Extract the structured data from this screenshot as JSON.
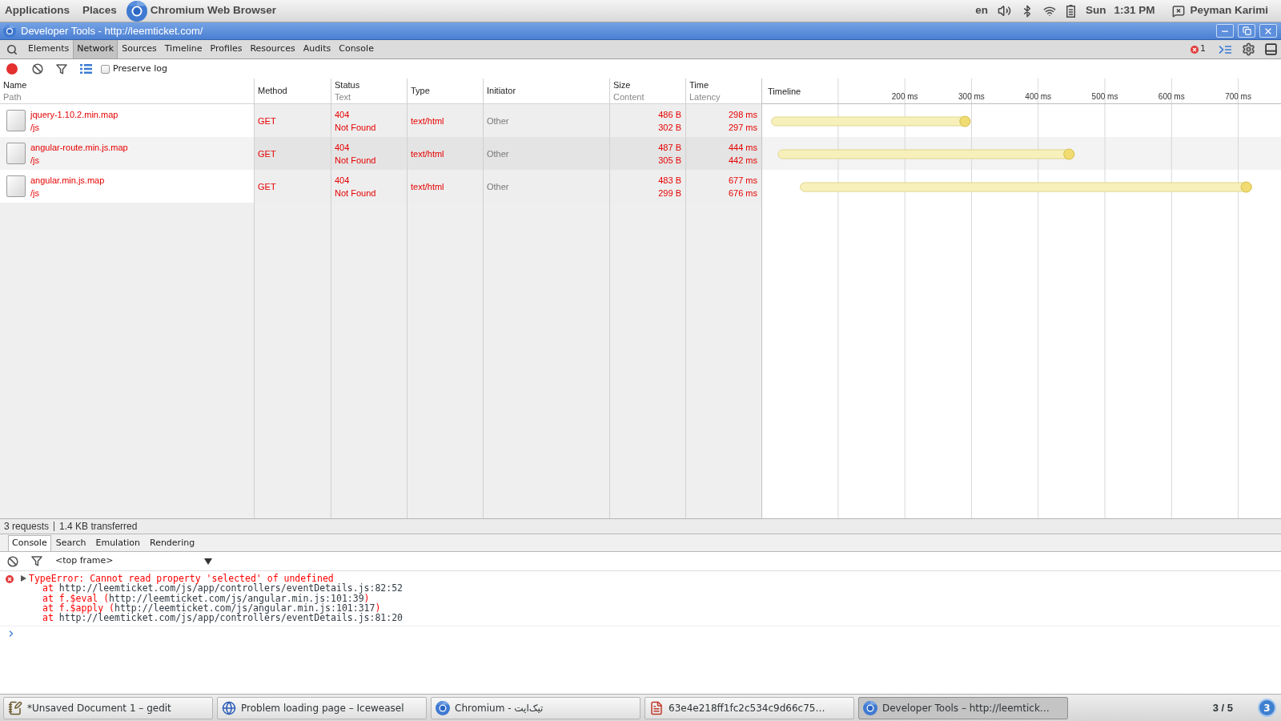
{
  "top_bar": {
    "menus": [
      "Applications",
      "Places"
    ],
    "app_name": "Chromium Web Browser",
    "language": "en",
    "day": "Sun",
    "time": "1:31 PM",
    "user": "Peyman Karimi"
  },
  "window": {
    "title": "Developer Tools - http://leemticket.com/"
  },
  "panel_tabs": [
    {
      "label": "Elements",
      "selected": false
    },
    {
      "label": "Network",
      "selected": true
    },
    {
      "label": "Sources",
      "selected": false
    },
    {
      "label": "Timeline",
      "selected": false
    },
    {
      "label": "Profiles",
      "selected": false
    },
    {
      "label": "Resources",
      "selected": false
    },
    {
      "label": "Audits",
      "selected": false
    },
    {
      "label": "Console",
      "selected": false
    }
  ],
  "error_count": "1",
  "network_toolbar": {
    "recording": true,
    "large_rows": true,
    "preserve_log": {
      "label": "Preserve log",
      "checked": false
    }
  },
  "table": {
    "columns": [
      {
        "title": "Name",
        "subtitle": "Path"
      },
      {
        "title": "Method"
      },
      {
        "title": "Status",
        "subtitle": "Text"
      },
      {
        "title": "Type"
      },
      {
        "title": "Initiator"
      },
      {
        "title": "Size",
        "subtitle": "Content"
      },
      {
        "title": "Time",
        "subtitle": "Latency"
      },
      {
        "title": "Timeline"
      }
    ],
    "rows": [
      {
        "name": "jquery-1.10.2.min.map",
        "path": "/js",
        "method": "GET",
        "status": "404",
        "status_text": "Not Found",
        "type": "text/html",
        "initiator": "Other",
        "size": "486 B",
        "content": "302 B",
        "time": "298 ms",
        "latency": "297 ms",
        "error": true
      },
      {
        "name": "angular-route.min.js.map",
        "path": "/js",
        "method": "GET",
        "status": "404",
        "status_text": "Not Found",
        "type": "text/html",
        "initiator": "Other",
        "size": "487 B",
        "content": "305 B",
        "time": "444 ms",
        "latency": "442 ms",
        "error": true
      },
      {
        "name": "angular.min.js.map",
        "path": "/js",
        "method": "GET",
        "status": "404",
        "status_text": "Not Found",
        "type": "text/html",
        "initiator": "Other",
        "size": "483 B",
        "content": "299 B",
        "time": "677 ms",
        "latency": "676 ms",
        "error": true
      }
    ]
  },
  "timeline": {
    "chart_data": {
      "type": "bar",
      "orientation": "horizontal",
      "base": [
        0,
        10,
        43
      ],
      "values": [
        298,
        444,
        677
      ],
      "color": "#f7f0bb",
      "xlim": [
        -14,
        763
      ],
      "xticks": [
        {
          "value": 200,
          "label": "200 ms"
        },
        {
          "value": 300,
          "label": "300 ms"
        },
        {
          "value": 400,
          "label": "400 ms"
        },
        {
          "value": 500,
          "label": "500 ms"
        },
        {
          "value": 600,
          "label": "600 ms"
        },
        {
          "value": 700,
          "label": "700 ms"
        }
      ],
      "grid": true
    }
  },
  "status_bar": {
    "requests": "3 requests",
    "transferred": "1.4 KB transferred"
  },
  "drawer_tabs": [
    {
      "label": "Console",
      "selected": true
    },
    {
      "label": "Search",
      "selected": false
    },
    {
      "label": "Emulation",
      "selected": false
    },
    {
      "label": "Rendering",
      "selected": false
    }
  ],
  "console": {
    "context": "<top frame>",
    "messages": [
      {
        "kind": "error",
        "expanded": false,
        "text": "TypeError: Cannot read property 'selected' of undefined",
        "stack": [
          {
            "prefix": "at ",
            "url": "http://leemticket.com/js/app/controllers/eventDetails.js:82:52"
          },
          {
            "prefix": "at f.$eval (",
            "url": "http://leemticket.com/js/angular.min.js:101:39",
            "suffix": ")"
          },
          {
            "prefix": "at f.$apply (",
            "url": "http://leemticket.com/js/angular.min.js:101:317",
            "suffix": ")"
          },
          {
            "prefix": "at ",
            "url": "http://leemticket.com/js/app/controllers/eventDetails.js:81:20"
          }
        ]
      }
    ]
  },
  "taskbar": {
    "windows": [
      {
        "kind": "editor",
        "title": "*Unsaved Document 1 – gedit",
        "selected": false
      },
      {
        "kind": "globe",
        "title": "Problem loading page – Iceweasel",
        "selected": false
      },
      {
        "kind": "browser",
        "title": "Chromium - تیک‌ایت",
        "selected": false
      },
      {
        "kind": "document",
        "title": "63e4e218ff1fc2c534c9d66c75…",
        "selected": false
      },
      {
        "kind": "browser",
        "title": "Developer Tools – http://leemtick…",
        "selected": true
      }
    ],
    "workspace": "3 / 5",
    "workspace_badge": "3"
  }
}
